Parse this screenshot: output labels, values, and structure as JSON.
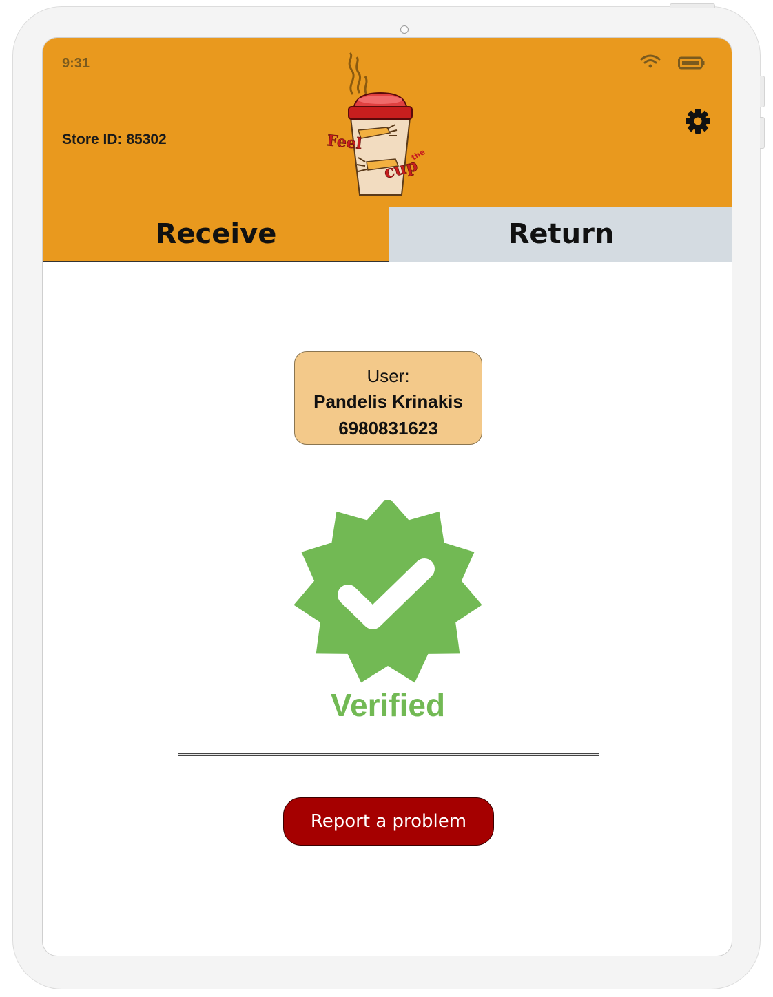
{
  "status_bar": {
    "time": "9:31"
  },
  "header": {
    "store_id": "Store ID: 85302",
    "logo_word_1": "Feel",
    "logo_word_2": "the",
    "logo_word_3": "cup"
  },
  "tabs": [
    {
      "label": "Receive",
      "active": true
    },
    {
      "label": "Return",
      "active": false
    }
  ],
  "user": {
    "label": "User:",
    "name": "Pandelis Krinakis",
    "phone": "6980831623"
  },
  "status": {
    "text": "Verified",
    "color": "#72b954"
  },
  "report_button": {
    "label": "Report a problem"
  },
  "colors": {
    "header": "#e9991e",
    "inactive_tab": "#d4dbe1",
    "user_card": "#f3c98a",
    "report_button": "#a50000"
  },
  "icons": [
    "wifi-icon",
    "battery-icon",
    "gear-icon",
    "verified-badge-icon"
  ]
}
